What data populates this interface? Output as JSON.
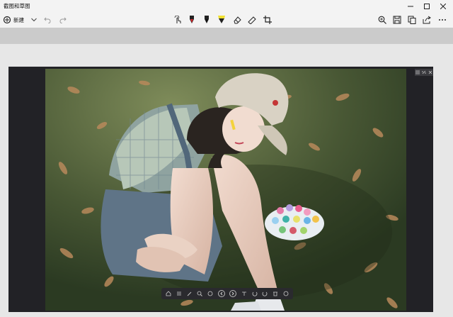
{
  "window": {
    "title": "截图和草图"
  },
  "toolbar": {
    "new_label": "新建"
  },
  "icons": {
    "new": "new-snip-icon",
    "dropdown": "chevron-down-icon",
    "undo": "undo-icon",
    "redo": "redo-icon",
    "touch": "touch-writing-icon",
    "pen_red": "ballpoint-pen-icon",
    "pen_black": "pencil-icon",
    "highlighter": "highlighter-icon",
    "eraser": "eraser-icon",
    "ruler": "ruler-icon",
    "crop": "crop-icon",
    "zoom": "zoom-in-icon",
    "save": "save-icon",
    "copy": "copy-icon",
    "share": "share-icon",
    "more": "more-icon"
  },
  "colors": {
    "pen_red": "#d8272b",
    "pen_black": "#111111",
    "highlighter": "#f0e030",
    "accent": "#0067c0"
  }
}
